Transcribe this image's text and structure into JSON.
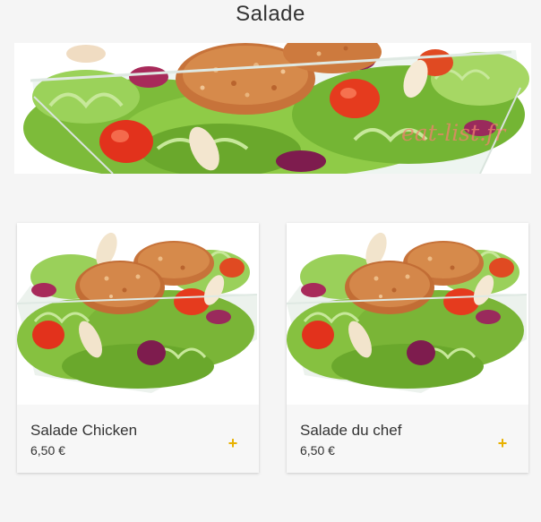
{
  "header": {
    "title": "Salade"
  },
  "hero": {
    "image_alt": "Salade",
    "watermark": "eat-list.fr"
  },
  "products": [
    {
      "name": "Salade Chicken",
      "price": "6,50 €",
      "add_label": "+",
      "icon": "plus-icon"
    },
    {
      "name": "Salade du chef",
      "price": "6,50 €",
      "add_label": "+",
      "icon": "plus-icon"
    }
  ],
  "colors": {
    "background": "#f5f5f5",
    "card": "#ffffff",
    "card_footer": "#f7f7f7",
    "accent_add": "#e8b100",
    "watermark": "#f0826e"
  }
}
